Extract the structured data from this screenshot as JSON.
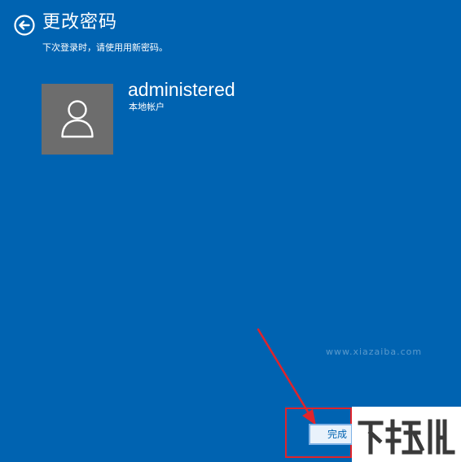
{
  "header": {
    "back_icon": "back-arrow-circle-icon",
    "title": "更改密码",
    "subtitle": "下次登录时，请使用用新密码。"
  },
  "account": {
    "avatar_icon": "user-icon",
    "name": "administered",
    "type": "本地帐户"
  },
  "footer": {
    "finish_label": "完成"
  },
  "annotation": {
    "color": "#e0242b"
  },
  "watermark": {
    "url": "www.xiazaiba.com",
    "logo": "下载吧"
  },
  "colors": {
    "background": "#0063b1",
    "avatar_background": "#6d6d6d",
    "text": "#ffffff"
  }
}
